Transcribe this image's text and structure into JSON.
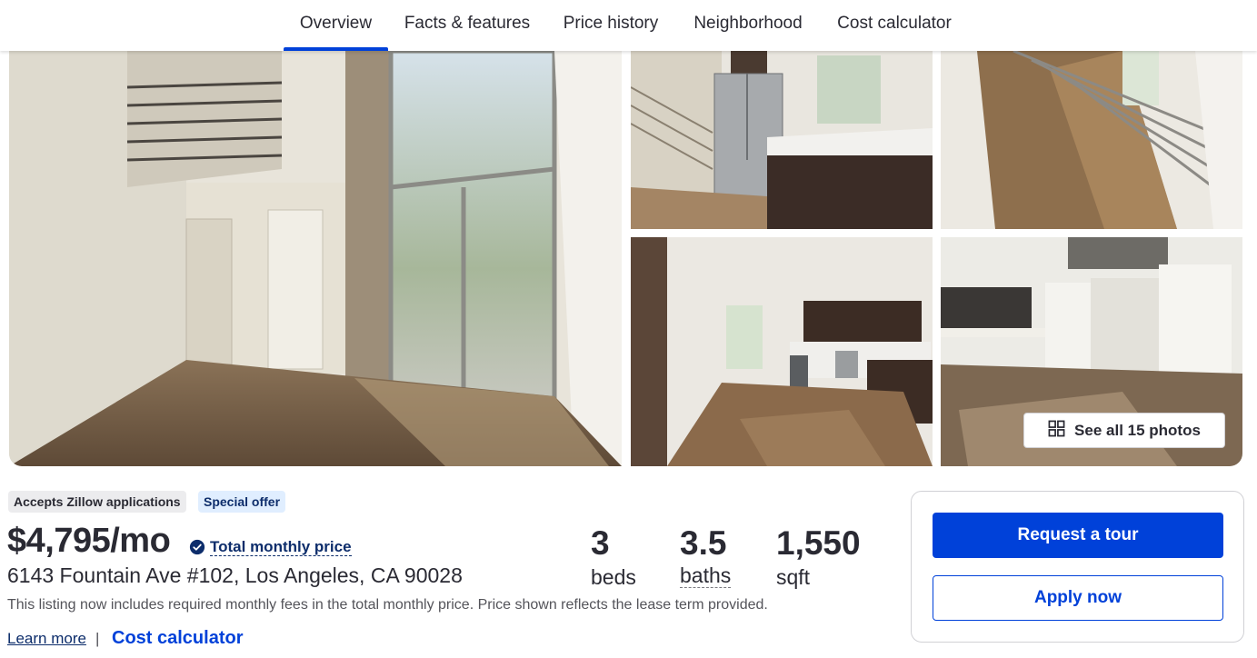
{
  "nav": {
    "tabs": [
      {
        "label": "Overview",
        "active": true
      },
      {
        "label": "Facts & features",
        "active": false
      },
      {
        "label": "Price history",
        "active": false
      },
      {
        "label": "Neighborhood",
        "active": false
      },
      {
        "label": "Cost calculator",
        "active": false
      }
    ]
  },
  "gallery": {
    "see_all_label": "See all 15 photos",
    "icon": "grid-icon"
  },
  "badges": {
    "applications": "Accepts Zillow applications",
    "special_offer": "Special offer"
  },
  "listing": {
    "price": "$4,795/mo",
    "total_monthly_price_label": "Total monthly price",
    "address": "6143 Fountain Ave #102, Los Angeles, CA 90028",
    "disclaimer": "This listing now includes required monthly fees in the total monthly price. Price shown reflects the lease term provided.",
    "learn_more": "Learn more",
    "separator": "|",
    "cost_calculator": "Cost calculator"
  },
  "stats": {
    "beds_value": "3",
    "beds_label": "beds",
    "baths_value": "3.5",
    "baths_label": "baths",
    "sqft_value": "1,550",
    "sqft_label": "sqft"
  },
  "actions": {
    "request_tour": "Request a tour",
    "apply_now": "Apply now"
  },
  "colors": {
    "accent": "#0041d9",
    "dark_blue": "#0d2d6b",
    "text": "#2a2a33"
  }
}
